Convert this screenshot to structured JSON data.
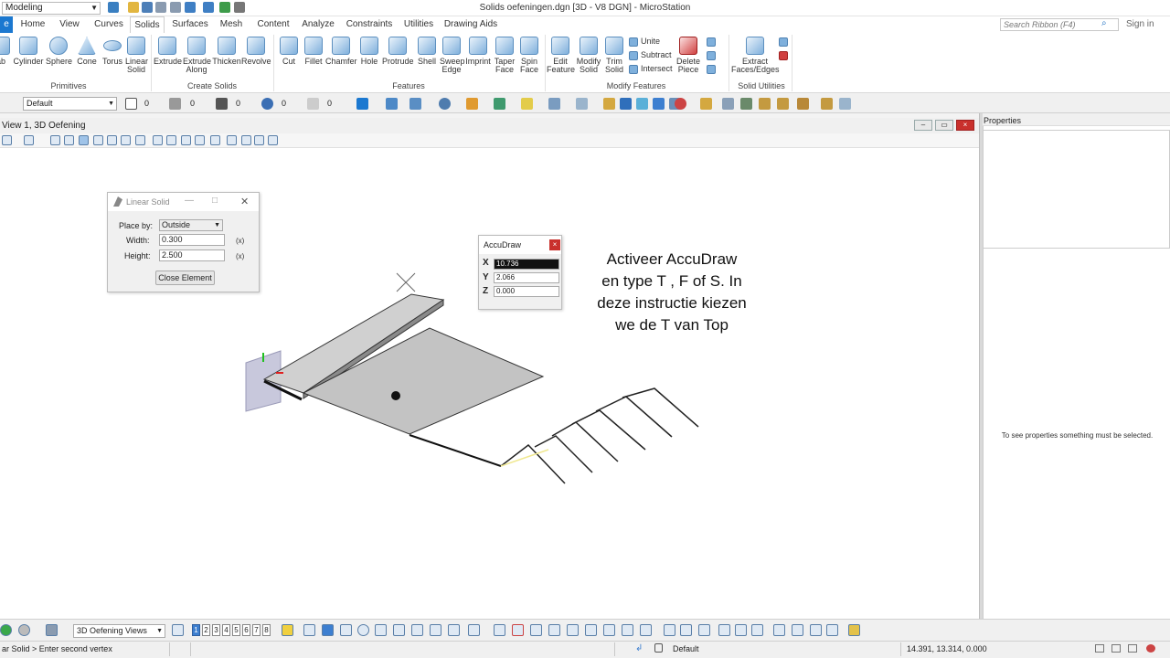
{
  "window": {
    "title": "Solids oefeningen.dgn [3D - V8 DGN] - MicroStation",
    "workflow": "Modeling"
  },
  "ribbon": {
    "tabs": [
      "Home",
      "View",
      "Curves",
      "Solids",
      "Surfaces",
      "Mesh",
      "Content",
      "Analyze",
      "Constraints",
      "Utilities",
      "Drawing Aids"
    ],
    "active_tab": "Solids",
    "search_placeholder": "Search Ribbon (F4)",
    "sign_in": "Sign in",
    "groups": {
      "primitives": {
        "label": "Primitives",
        "buttons": [
          "ab",
          "Cylinder",
          "Sphere",
          "Cone",
          "Torus",
          "Linear Solid"
        ]
      },
      "create_solids": {
        "label": "Create Solids",
        "buttons": [
          "Extrude",
          "Extrude Along",
          "Thicken",
          "Revolve"
        ]
      },
      "features": {
        "label": "Features",
        "buttons": [
          "Cut",
          "Fillet",
          "Chamfer",
          "Hole",
          "Protrude",
          "Shell",
          "Sweep Edge",
          "Imprint",
          "Taper Face",
          "Spin Face"
        ]
      },
      "modify_features": {
        "label": "Modify Features",
        "buttons": [
          "Edit Feature",
          "Modify Solid",
          "Trim Solid",
          "Delete Piece"
        ],
        "small_buttons": [
          "Unite",
          "Subtract",
          "Intersect"
        ]
      },
      "solid_utilities": {
        "label": "Solid Utilities",
        "buttons": [
          "Extract Faces/Edges"
        ]
      }
    }
  },
  "attributes": {
    "level": "Default",
    "color_idx": "0",
    "weight_idx": "0",
    "style_idx": "0",
    "trans_idx": "0",
    "priority_idx": "0"
  },
  "view": {
    "title": "View 1, 3D Oefening"
  },
  "properties": {
    "title": "Properties",
    "empty_message": "To see properties something must be selected."
  },
  "linear_solid": {
    "title": "Linear Solid",
    "place_by_label": "Place by:",
    "place_by_value": "Outside",
    "width_label": "Width:",
    "width_value": "0.300",
    "height_label": "Height:",
    "height_value": "2.500",
    "lock_glyph": "(x)",
    "close_button": "Close Element"
  },
  "accudraw": {
    "title": "AccuDraw",
    "x_label": "X",
    "x_value": "10.736",
    "y_label": "Y",
    "y_value": "2.066",
    "z_label": "Z",
    "z_value": "0.000"
  },
  "instruction": {
    "line1": "Activeer AccuDraw",
    "line2": "en type T , F of S. In",
    "line3": "deze instructie kiezen",
    "line4": "we de T van Top"
  },
  "bottom": {
    "view_group": "3D Oefening Views",
    "views": [
      "1",
      "2",
      "3",
      "4",
      "5",
      "6",
      "7",
      "8"
    ]
  },
  "status": {
    "prompt": "ar Solid > Enter second vertex",
    "level": "Default",
    "coords": "14.391, 13.314, 0.000"
  }
}
